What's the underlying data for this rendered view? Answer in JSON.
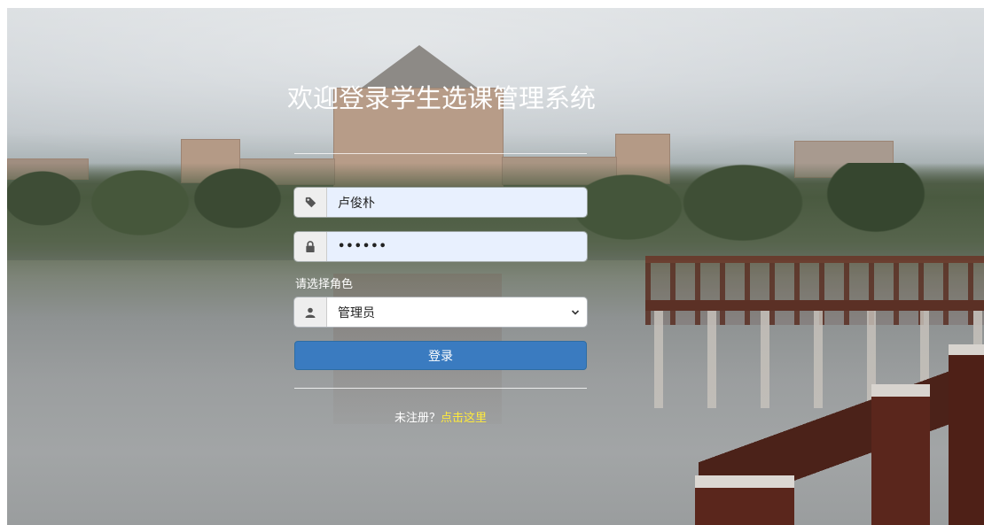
{
  "page": {
    "title": "欢迎登录学生选课管理系统"
  },
  "login": {
    "username_value": "卢俊朴",
    "password_mask": "••••••",
    "role_label": "请选择角色",
    "role_selected": "管理员",
    "submit_label": "登录",
    "register_prompt": "未注册？",
    "register_link": "点击这里"
  },
  "colors": {
    "primary_button": "#3a7bc0",
    "link": "#ffeb3b",
    "autofill_bg": "#e8f0fe"
  },
  "icons": {
    "username": "tag-icon",
    "password": "lock-icon",
    "role": "user-icon",
    "select": "chevron-down-icon"
  }
}
